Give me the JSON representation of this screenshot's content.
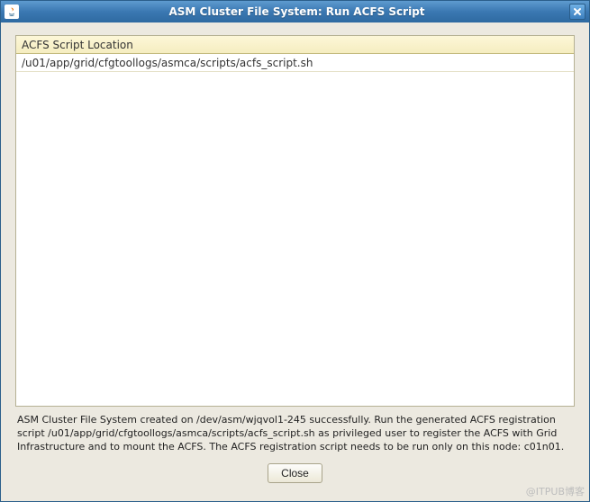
{
  "window": {
    "title": "ASM Cluster File System: Run ACFS Script"
  },
  "table": {
    "header": "ACFS Script Location",
    "rows": [
      "/u01/app/grid/cfgtoollogs/asmca/scripts/acfs_script.sh"
    ]
  },
  "message": "ASM Cluster File System created on /dev/asm/wjqvol1-245 successfully. Run the generated ACFS registration script /u01/app/grid/cfgtoollogs/asmca/scripts/acfs_script.sh as privileged user to register the ACFS with Grid Infrastructure and to mount the ACFS. The ACFS registration script needs to be run only on this node: c01n01.",
  "buttons": {
    "close": "Close"
  },
  "watermark": "@ITPUB博客"
}
